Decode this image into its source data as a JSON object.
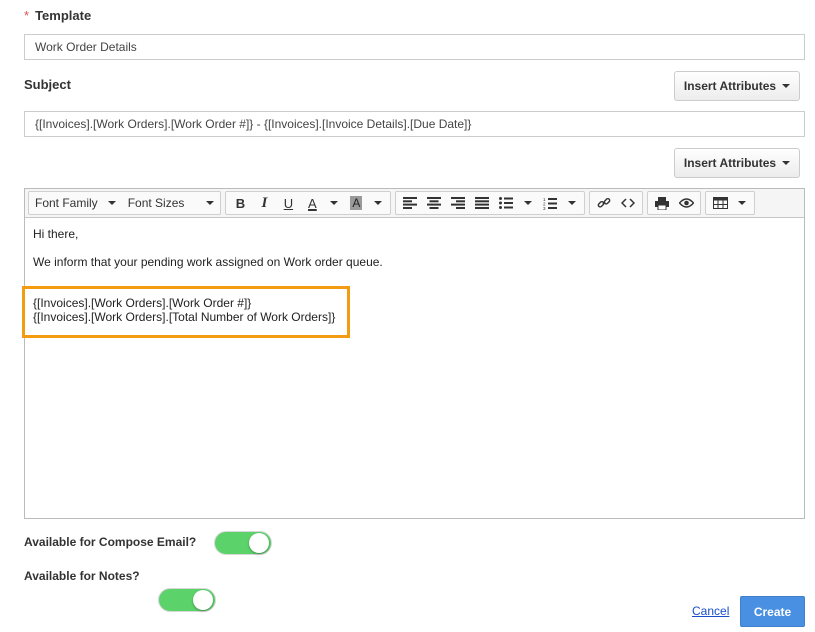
{
  "template": {
    "required_mark": "*",
    "label": "Template",
    "value": "Work Order Details"
  },
  "subject": {
    "label": "Subject",
    "insert_attributes_label": "Insert Attributes",
    "value": "{[Invoices].[Work Orders].[Work Order #]} - {[Invoices].[Invoice Details].[Due Date]}"
  },
  "body": {
    "insert_attributes_label": "Insert Attributes",
    "toolbar": {
      "font_family": "Font Family",
      "font_sizes": "Font Sizes",
      "bold": "B",
      "italic": "I",
      "underline": "U",
      "font_color": "A",
      "bg_color": "A"
    },
    "lines": [
      "Hi there,",
      "We inform that your pending work assigned on Work order queue.",
      "{[Invoices].[Work Orders].[Work Order #]}",
      "{[Invoices].[Work Orders].[Total Number of Work Orders]}"
    ]
  },
  "options": {
    "compose_email_label": "Available for Compose Email?",
    "compose_email_on": true,
    "notes_label": "Available for Notes?",
    "notes_on": true
  },
  "actions": {
    "cancel_label": "Cancel",
    "create_label": "Create"
  },
  "colors": {
    "toggle_on": "#5cd26b",
    "highlight": "#f39c12",
    "primary": "#4a90e2"
  }
}
